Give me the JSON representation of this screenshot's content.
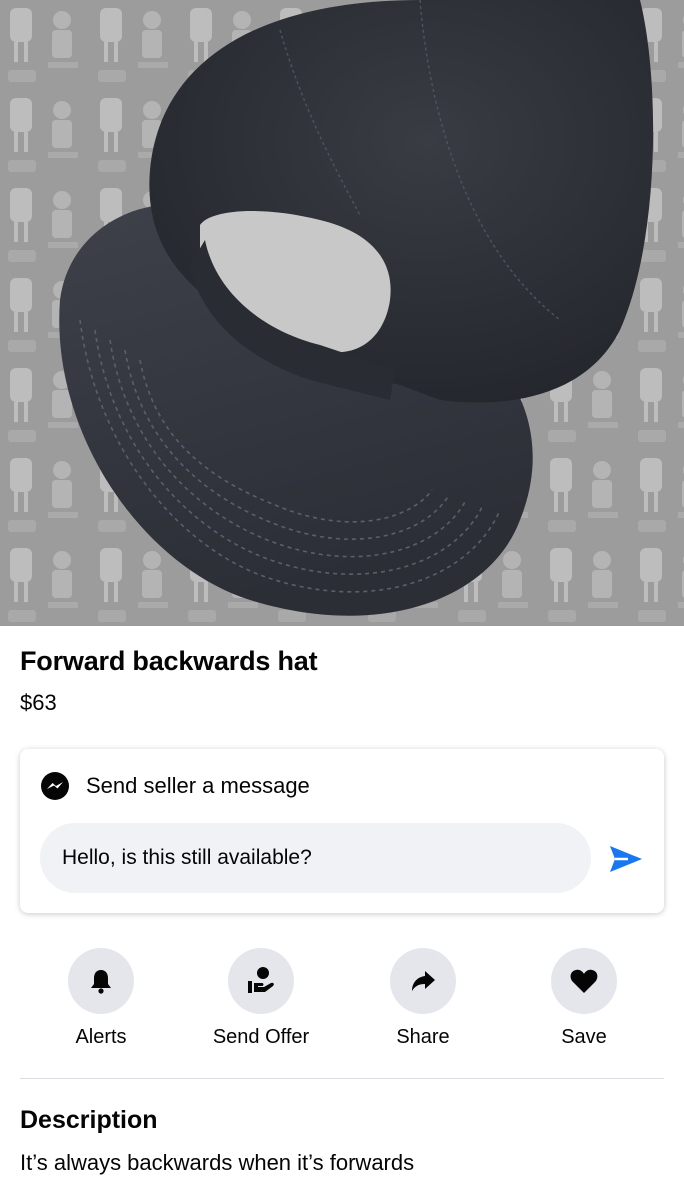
{
  "listing": {
    "photo_icon": "product-photo-black-baseball-cap",
    "title": "Forward backwards hat",
    "price": "$63"
  },
  "message": {
    "header_icon": "messenger-icon",
    "header_label": "Send seller a message",
    "input_value": "Hello, is this still available?",
    "send_icon": "send-icon",
    "accent_color": "#1877f2"
  },
  "actions": [
    {
      "label": "Alerts",
      "icon": "bell-icon"
    },
    {
      "label": "Send Offer",
      "icon": "offer-icon"
    },
    {
      "label": "Share",
      "icon": "share-arrow-icon"
    },
    {
      "label": "Save",
      "icon": "heart-icon"
    }
  ],
  "description": {
    "heading": "Description",
    "text": "It’s always backwards when it’s forwards"
  }
}
